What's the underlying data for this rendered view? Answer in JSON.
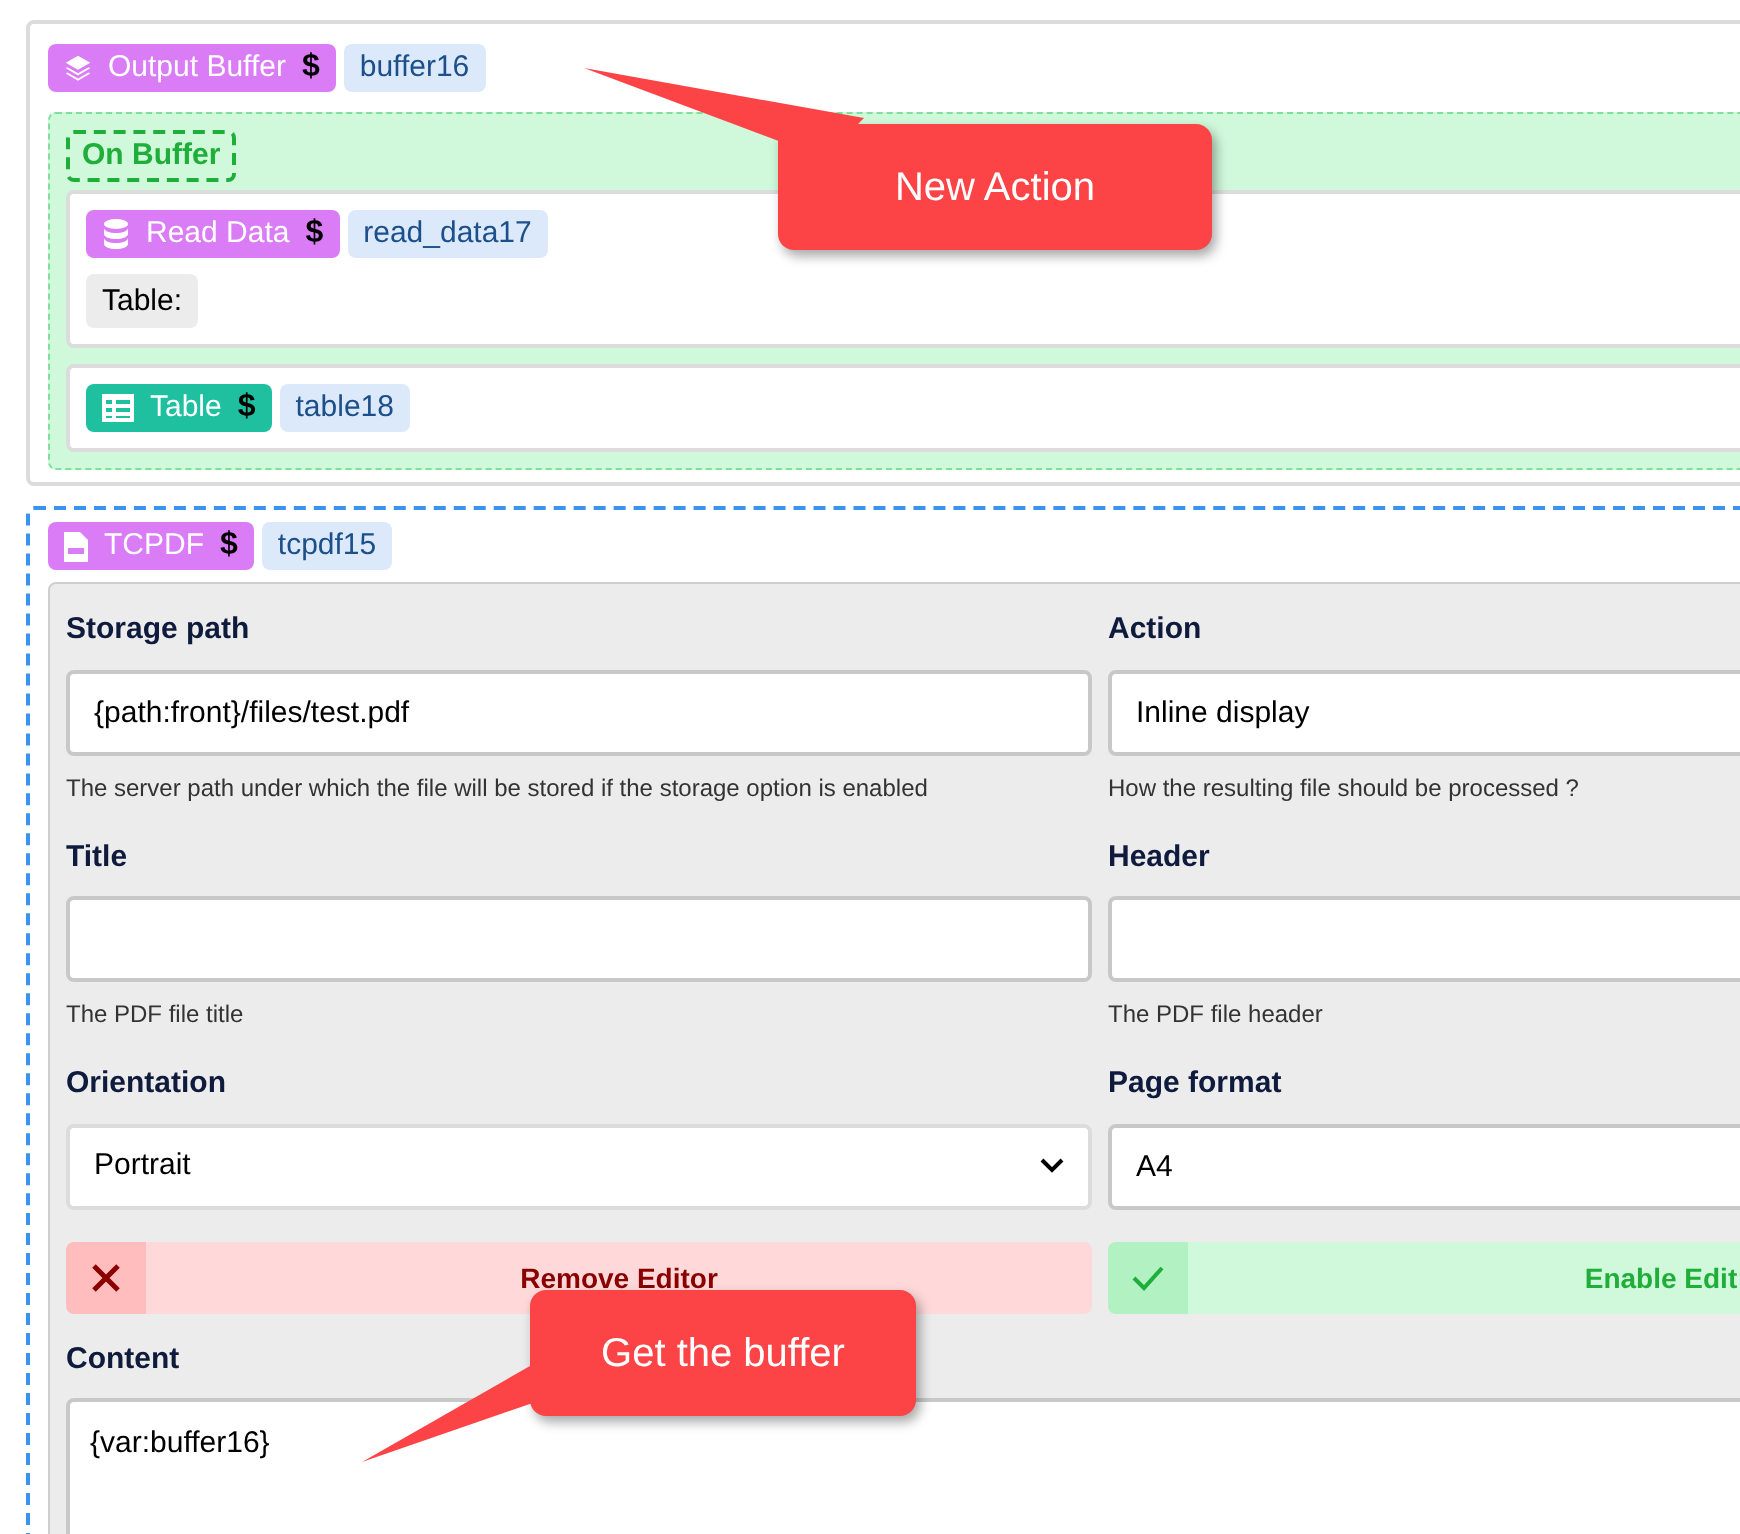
{
  "buffer_block": {
    "badge": "Output Buffer",
    "symbol": "$",
    "id": "buffer16",
    "event_label": "On Buffer",
    "actions": [
      {
        "kind": "read_data",
        "badge": "Read Data",
        "symbol": "$",
        "id": "read_data17",
        "field_label": "Table:"
      },
      {
        "kind": "table",
        "badge": "Table",
        "symbol": "$",
        "id": "table18"
      }
    ]
  },
  "pdf_block": {
    "badge": "TCPDF",
    "symbol": "$",
    "id": "tcpdf15",
    "fields": [
      {
        "kind": "input",
        "label": "Storage path",
        "value": "{path:front}/files/test.pdf",
        "help": "The server path under which the file will be stored if the storage option is enabled"
      },
      {
        "kind": "input",
        "label": "Action",
        "value": "Inline display",
        "help": "How the resulting file should be processed ?"
      },
      {
        "kind": "input",
        "label": "Title",
        "help": "The PDF file title"
      },
      {
        "kind": "input",
        "label": "Header",
        "help": "The PDF file header"
      },
      {
        "kind": "select",
        "label": "Orientation",
        "value": "Portrait"
      },
      {
        "kind": "input",
        "label": "Page format",
        "value": "A4"
      }
    ],
    "toggles": [
      {
        "kind": "remove",
        "label": "Remove Editor"
      },
      {
        "kind": "enable",
        "label": "Enable Edit"
      }
    ],
    "content": {
      "label": "Content",
      "value": "{var:buffer16}"
    }
  },
  "callouts": [
    {
      "text": "New Action"
    },
    {
      "text": "Get the buffer"
    }
  ]
}
